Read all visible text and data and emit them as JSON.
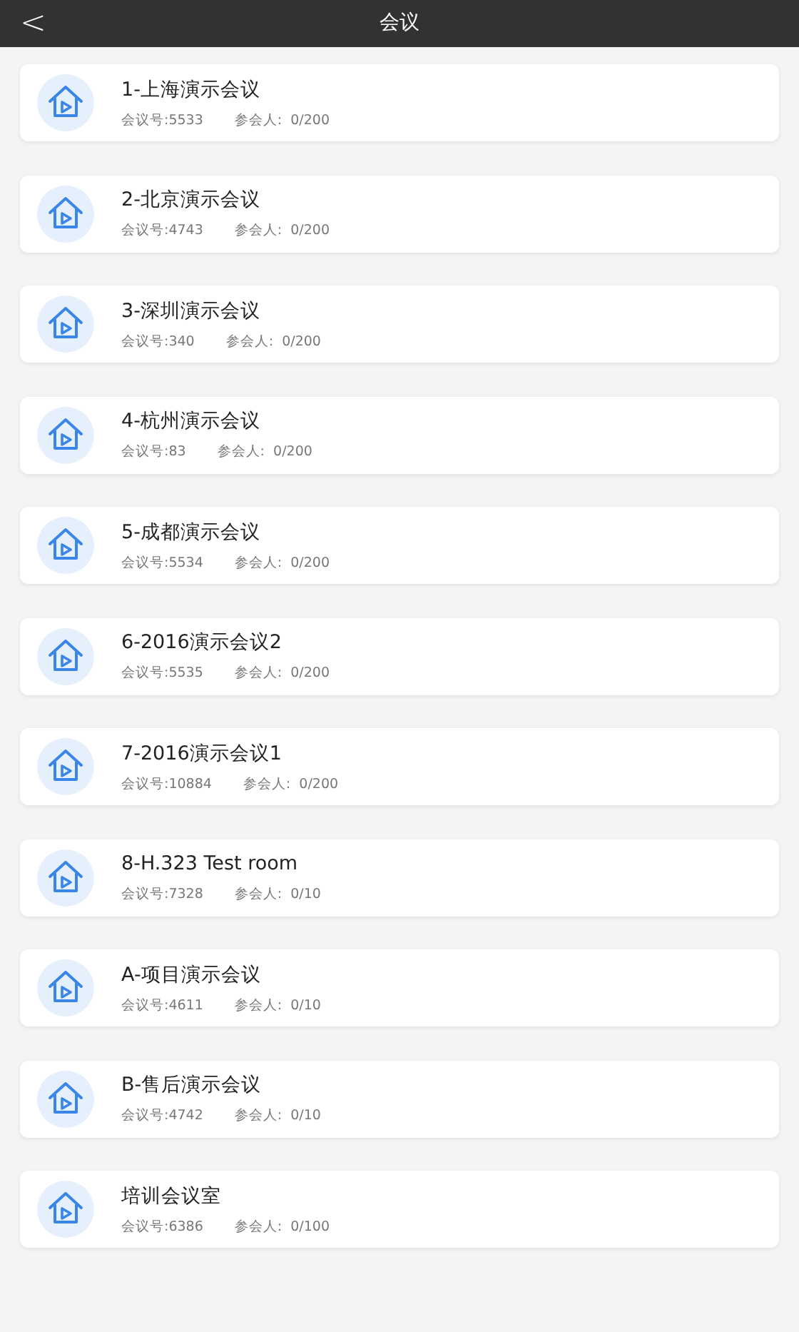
{
  "header": {
    "back": "<",
    "title": "会议"
  },
  "meetings": [
    {
      "title": "1-上海演示会议",
      "number": "会议号:5533",
      "participants": "参会人:  0/200"
    },
    {
      "title": "2-北京演示会议",
      "number": "会议号:4743",
      "participants": "参会人:  0/200"
    },
    {
      "title": "3-深圳演示会议",
      "number": "会议号:340",
      "participants": "参会人:  0/200"
    },
    {
      "title": "4-杭州演示会议",
      "number": "会议号:83",
      "participants": "参会人:  0/200"
    },
    {
      "title": "5-成都演示会议",
      "number": "会议号:5534",
      "participants": "参会人:  0/200"
    },
    {
      "title": "6-2016演示会议2",
      "number": "会议号:5535",
      "participants": "参会人:  0/200"
    },
    {
      "title": "7-2016演示会议1",
      "number": "会议号:10884",
      "participants": "参会人:  0/200"
    },
    {
      "title": "8-H.323 Test room",
      "number": "会议号:7328",
      "participants": "参会人:  0/10"
    },
    {
      "title": "A-项目演示会议",
      "number": "会议号:4611",
      "participants": "参会人:  0/10"
    },
    {
      "title": "B-售后演示会议",
      "number": "会议号:4742",
      "participants": "参会人:  0/10"
    },
    {
      "title": "培训会议室",
      "number": "会议号:6386",
      "participants": "参会人:  0/100"
    }
  ]
}
